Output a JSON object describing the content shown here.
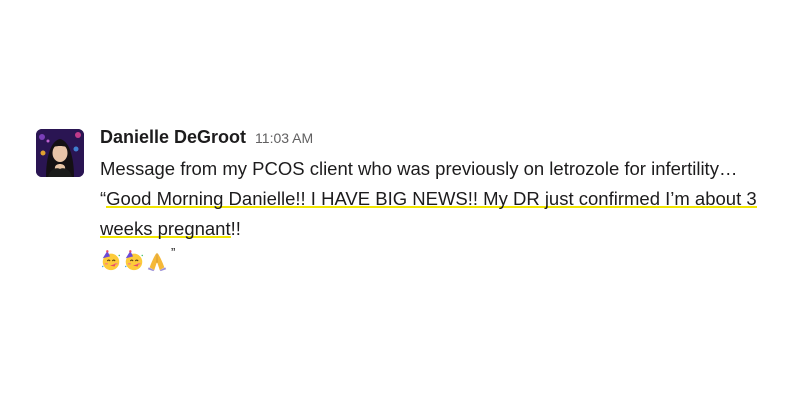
{
  "message": {
    "sender": "Danielle DeGroot",
    "timestamp": "11:03 AM",
    "text_intro": "Message from my PCOS client who was previously on letrozole for infertility… “",
    "text_highlighted": "Good Morning Danielle!! I HAVE BIG NEWS!! My DR just confirmed I’m about 3 weeks pregnant",
    "text_after": "!!",
    "emojis": [
      "partying-face-emoji",
      "partying-face-emoji",
      "folded-hands-emoji"
    ],
    "closing_quote": "”",
    "highlight_color": "#f2e600"
  }
}
